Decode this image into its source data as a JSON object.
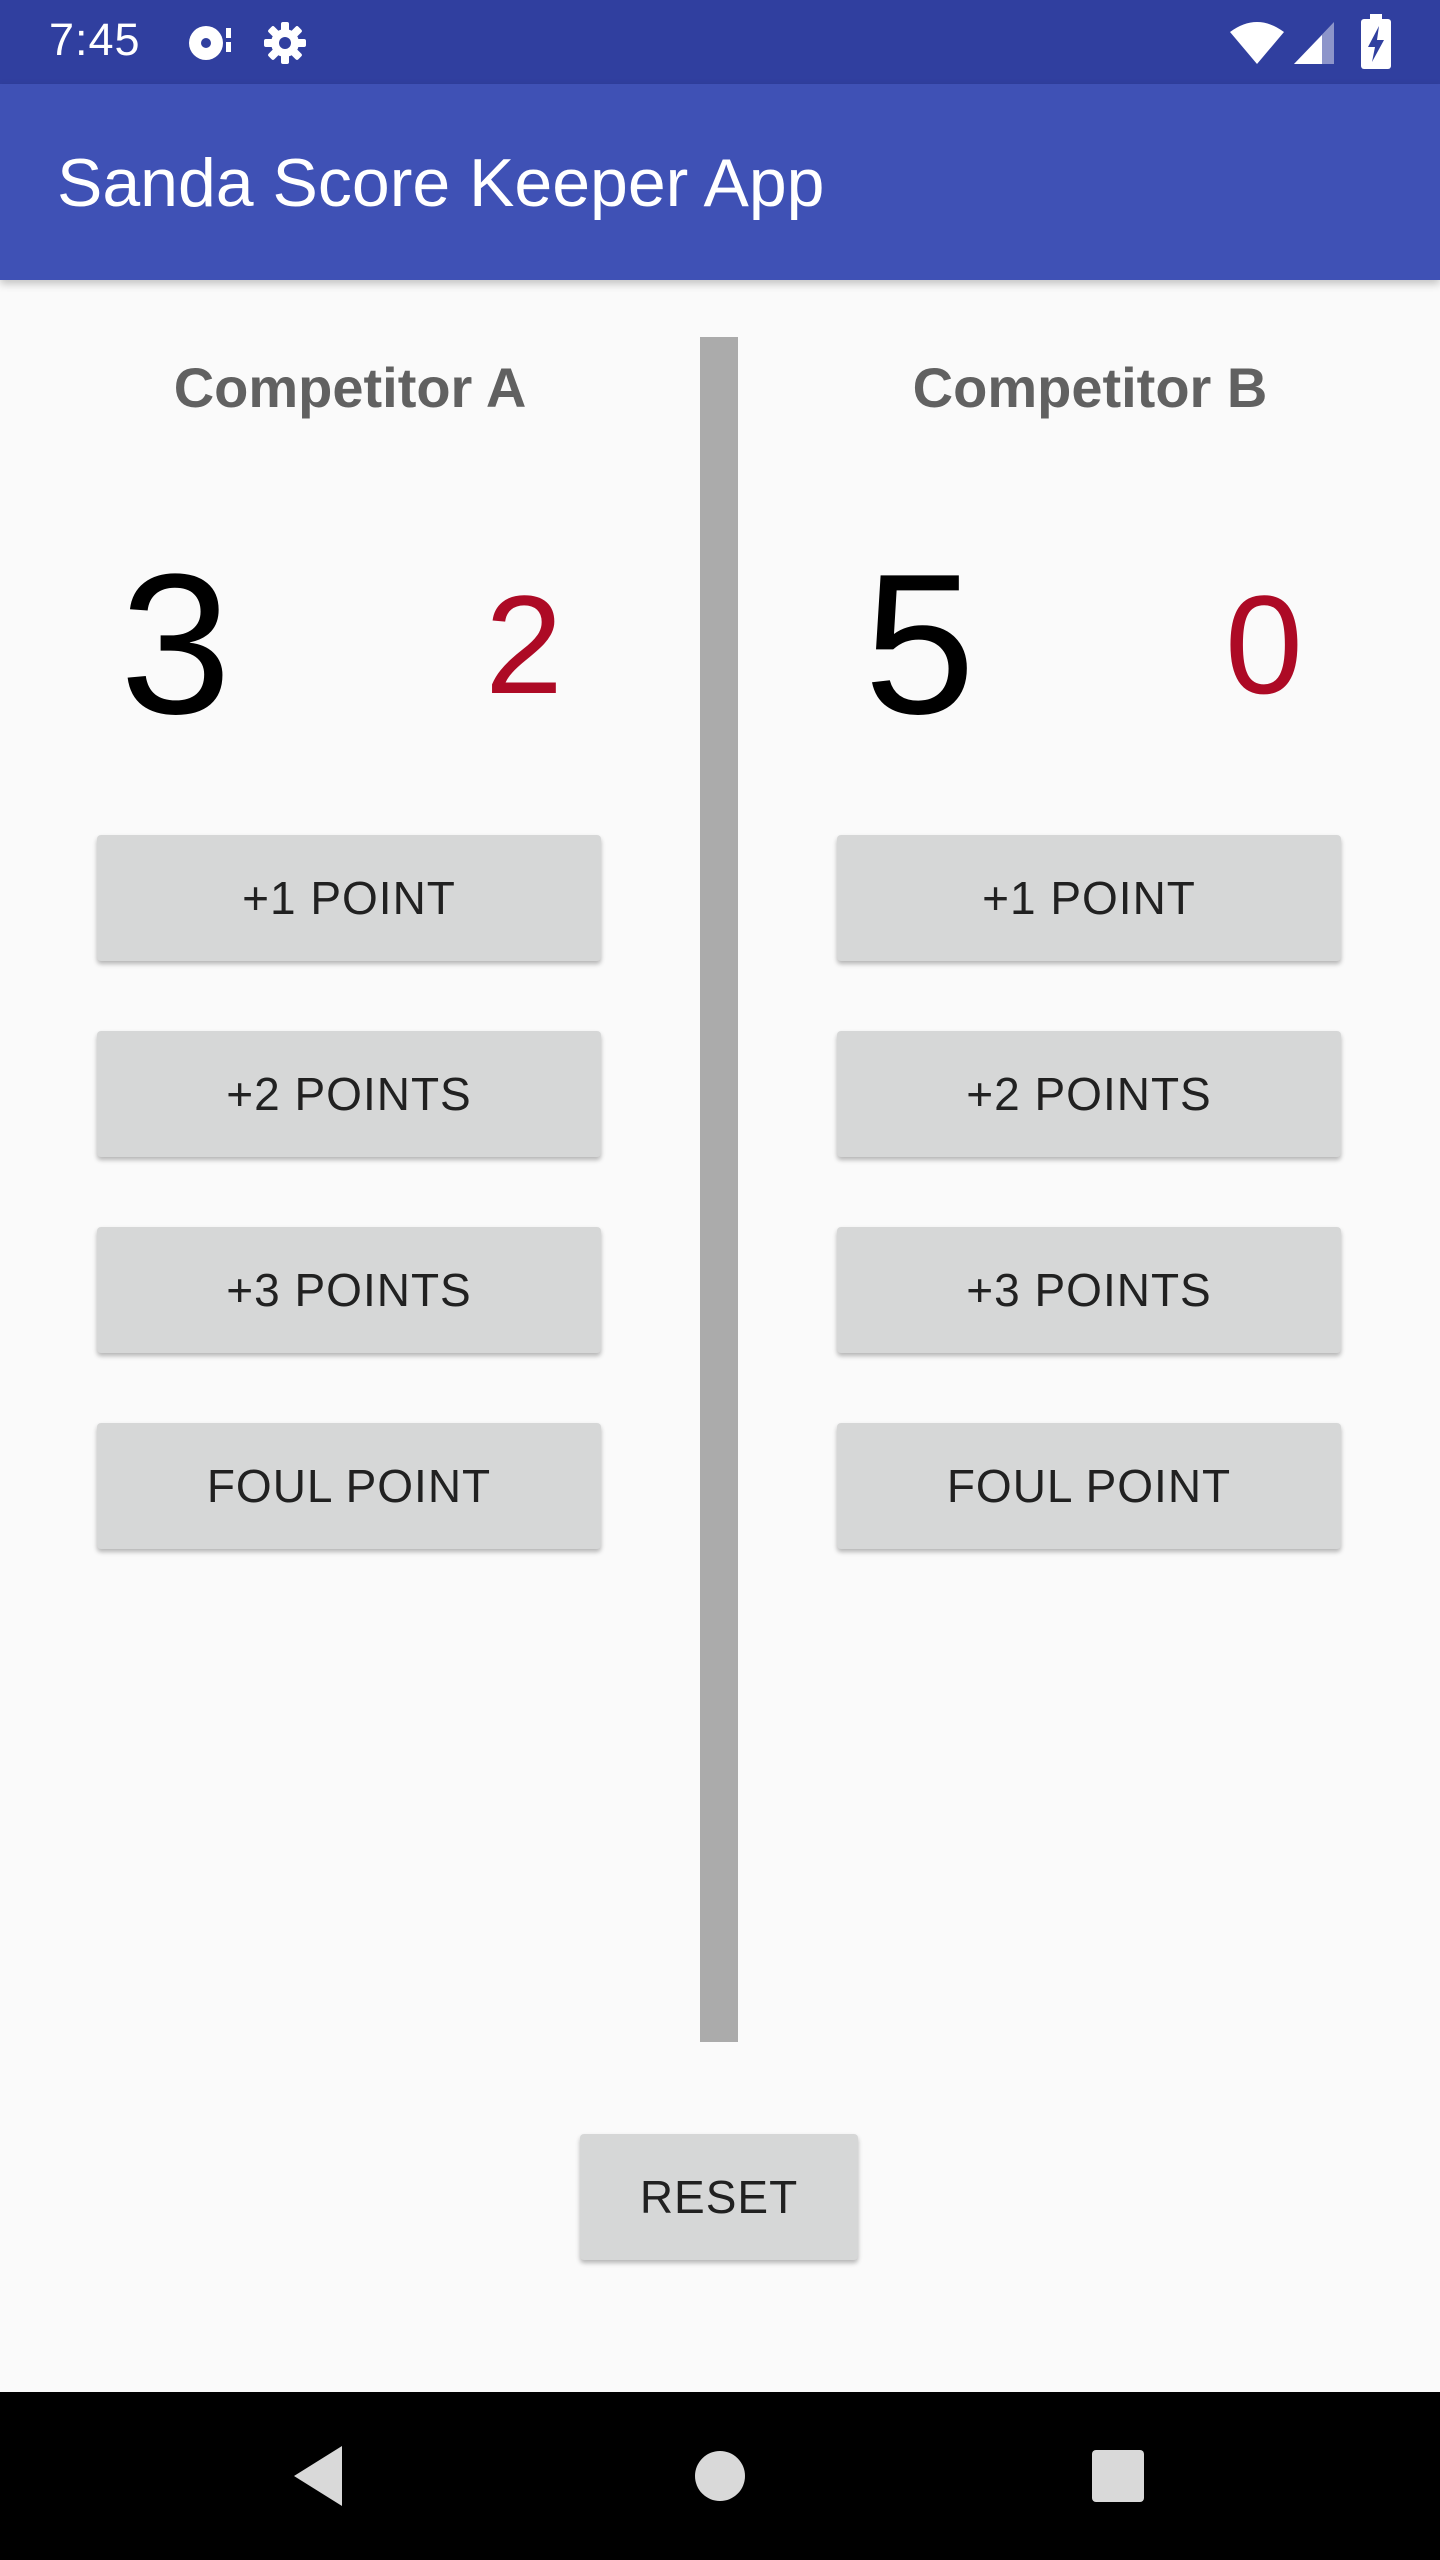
{
  "status_bar": {
    "time": "7:45",
    "icons": [
      "media-icon",
      "settings-icon",
      "wifi-icon",
      "signal-icon",
      "battery-charging-icon"
    ]
  },
  "app_bar": {
    "title": "Sanda Score Keeper App",
    "color": "#3f51b5"
  },
  "competitor_a": {
    "name": "Competitor A",
    "score": "3",
    "fouls": "2",
    "buttons": [
      "+1 POINT",
      "+2 POINTS",
      "+3 POINTS",
      "FOUL POINT"
    ]
  },
  "competitor_b": {
    "name": "Competitor B",
    "score": "5",
    "fouls": "0",
    "buttons": [
      "+1 POINT",
      "+2 POINTS",
      "+3 POINTS",
      "FOUL POINT"
    ]
  },
  "reset_label": "RESET",
  "nav_bar": {
    "icons": [
      "back-icon",
      "home-icon",
      "recents-icon"
    ]
  },
  "colors": {
    "status_bar": "#303f9f",
    "foul_text": "#ad0a25",
    "button_bg": "#d6d7d7",
    "divider": "#ababab"
  }
}
